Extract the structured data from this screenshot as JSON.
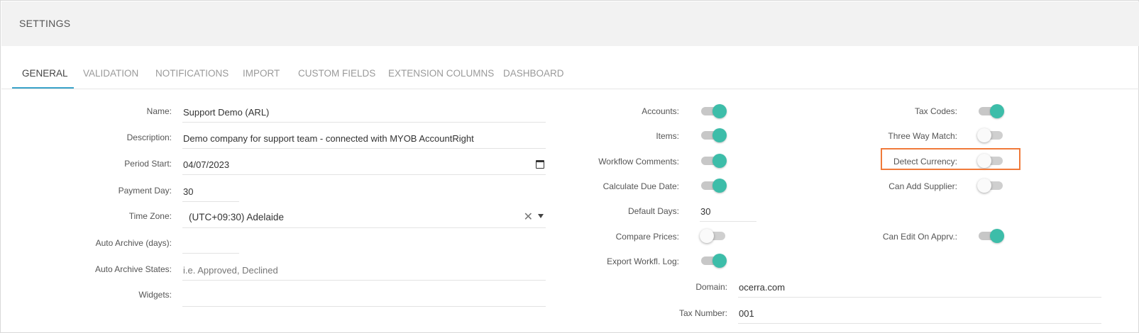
{
  "header": {
    "title": "SETTINGS"
  },
  "tabs": [
    {
      "label": "GENERAL",
      "active": true
    },
    {
      "label": "VALIDATION"
    },
    {
      "label": "NOTIFICATIONS"
    },
    {
      "label": "IMPORT"
    },
    {
      "label": "CUSTOM FIELDS"
    },
    {
      "label": "EXTENSION COLUMNS"
    },
    {
      "label": "DASHBOARD"
    }
  ],
  "form": {
    "name": {
      "label": "Name:",
      "value": "Support Demo (ARL)"
    },
    "description": {
      "label": "Description:",
      "value": "Demo company for support team - connected with MYOB AccountRight"
    },
    "period_start": {
      "label": "Period Start:",
      "value": "04/07/2023"
    },
    "payment_day": {
      "label": "Payment Day:",
      "value": "30"
    },
    "time_zone": {
      "label": "Time Zone:",
      "value": "(UTC+09:30) Adelaide"
    },
    "auto_archive_days": {
      "label": "Auto Archive (days):",
      "value": ""
    },
    "auto_archive_states": {
      "label": "Auto Archive States:",
      "placeholder": "i.e. Approved, Declined"
    },
    "widgets": {
      "label": "Widgets:",
      "value": ""
    }
  },
  "toggles_middle": [
    {
      "label": "Accounts:",
      "on": true
    },
    {
      "label": "Items:",
      "on": true
    },
    {
      "label": "Workflow Comments:",
      "on": true
    },
    {
      "label": "Calculate Due Date:",
      "on": true
    },
    {
      "label": "Compare Prices:",
      "on": false
    },
    {
      "label": "Export Workfl. Log:",
      "on": true
    }
  ],
  "default_days": {
    "label": "Default Days:",
    "value": "30"
  },
  "toggles_right": [
    {
      "label": "Tax Codes:",
      "on": true
    },
    {
      "label": "Three Way Match:",
      "on": false
    },
    {
      "label": "Detect Currency:",
      "on": false
    },
    {
      "label": "Can Add Supplier:",
      "on": false
    },
    {
      "label": "Can Edit On Apprv.:",
      "on": true
    }
  ],
  "domain": {
    "label": "Domain:",
    "value": "ocerra.com"
  },
  "tax_number": {
    "label": "Tax Number:",
    "value": "001"
  },
  "colors": {
    "accent": "#3dbda9",
    "tab_indicator": "#3aa3c9",
    "highlight": "#f07a3a",
    "header_bg": "#f2f2f2"
  }
}
